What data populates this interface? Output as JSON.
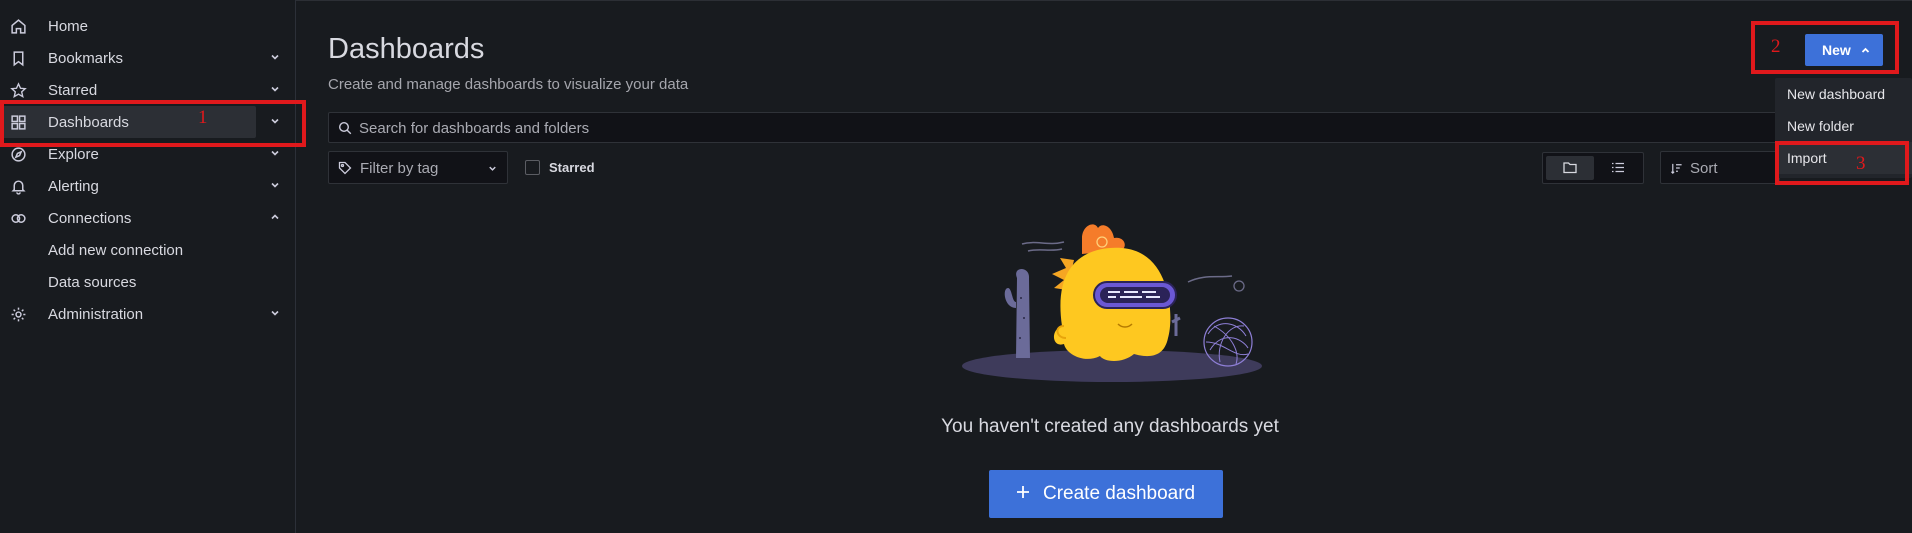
{
  "sidebar": {
    "items": [
      {
        "label": "Home",
        "icon": "home-icon"
      },
      {
        "label": "Bookmarks",
        "icon": "bookmark-icon"
      },
      {
        "label": "Starred",
        "icon": "star-icon"
      },
      {
        "label": "Dashboards",
        "icon": "apps-icon"
      },
      {
        "label": "Explore",
        "icon": "compass-icon"
      },
      {
        "label": "Alerting",
        "icon": "bell-icon"
      },
      {
        "label": "Connections",
        "icon": "link-icon"
      },
      {
        "label": "Administration",
        "icon": "gear-icon"
      }
    ],
    "sub_items": [
      "Add new connection",
      "Data sources"
    ]
  },
  "page": {
    "title": "Dashboards",
    "subtitle": "Create and manage dashboards to visualize your data"
  },
  "search": {
    "placeholder": "Search for dashboards and folders"
  },
  "filters": {
    "tag_placeholder": "Filter by tag",
    "starred_label": "Starred",
    "sort_label": "Sort"
  },
  "empty_state": {
    "message": "You haven't created any dashboards yet",
    "create_label": "Create dashboard"
  },
  "new_menu": {
    "button_label": "New",
    "items": [
      "New dashboard",
      "New folder",
      "Import"
    ]
  },
  "annotations": [
    "1",
    "2",
    "3"
  ],
  "colors": {
    "primary": "#3d71d9",
    "annotation": "#e0191c",
    "background": "#181b1f"
  }
}
